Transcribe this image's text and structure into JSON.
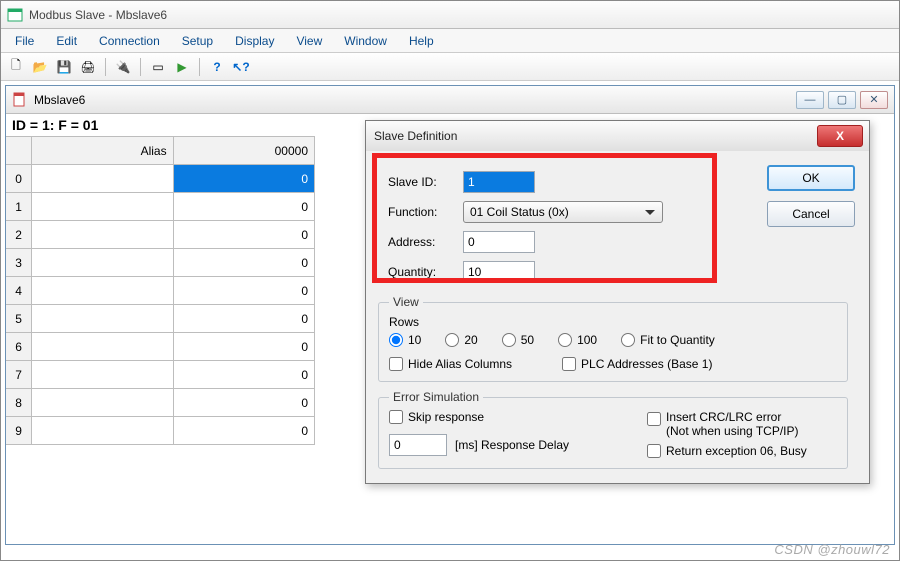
{
  "app": {
    "title": "Modbus Slave - Mbslave6",
    "icon": "app-icon"
  },
  "menu": [
    "File",
    "Edit",
    "Connection",
    "Setup",
    "Display",
    "View",
    "Window",
    "Help"
  ],
  "toolbar": [
    {
      "name": "new",
      "icon": "ico-new"
    },
    {
      "name": "open",
      "icon": "ico-open"
    },
    {
      "name": "save",
      "icon": "ico-save"
    },
    {
      "name": "print",
      "icon": "ico-print"
    },
    {
      "sep": true
    },
    {
      "name": "connection",
      "icon": "ico-cx"
    },
    {
      "sep": true
    },
    {
      "name": "window",
      "icon": "ico-win"
    },
    {
      "name": "run",
      "icon": "ico-run"
    },
    {
      "sep": true
    },
    {
      "name": "help",
      "icon": "ico-help"
    },
    {
      "name": "whats-this",
      "icon": "ico-ptr"
    }
  ],
  "doc": {
    "title": "Mbslave6",
    "status": "ID = 1: F = 01",
    "table": {
      "headers": {
        "rowh": "",
        "alias": "Alias",
        "value": "00000"
      },
      "rows": [
        {
          "n": "0",
          "alias": "",
          "value": "0",
          "selected": true
        },
        {
          "n": "1",
          "alias": "",
          "value": "0"
        },
        {
          "n": "2",
          "alias": "",
          "value": "0"
        },
        {
          "n": "3",
          "alias": "",
          "value": "0"
        },
        {
          "n": "4",
          "alias": "",
          "value": "0"
        },
        {
          "n": "5",
          "alias": "",
          "value": "0"
        },
        {
          "n": "6",
          "alias": "",
          "value": "0"
        },
        {
          "n": "7",
          "alias": "",
          "value": "0"
        },
        {
          "n": "8",
          "alias": "",
          "value": "0"
        },
        {
          "n": "9",
          "alias": "",
          "value": "0"
        }
      ]
    }
  },
  "dialog": {
    "title": "Slave Definition",
    "labels": {
      "slaveId": "Slave ID:",
      "function": "Function:",
      "address": "Address:",
      "quantity": "Quantity:"
    },
    "values": {
      "slaveId": "1",
      "function": "01 Coil Status (0x)",
      "address": "0",
      "quantity": "10"
    },
    "buttons": {
      "ok": "OK",
      "cancel": "Cancel"
    },
    "view": {
      "legend": "View",
      "rowsLabel": "Rows",
      "rowsOptions": [
        {
          "label": "10",
          "value": "10",
          "checked": true
        },
        {
          "label": "20",
          "value": "20"
        },
        {
          "label": "50",
          "value": "50"
        },
        {
          "label": "100",
          "value": "100"
        },
        {
          "label": "Fit to Quantity",
          "value": "fit"
        }
      ],
      "hideAlias": {
        "label": "Hide Alias Columns",
        "checked": false
      },
      "plcAddr": {
        "label": "PLC Addresses (Base 1)",
        "checked": false
      }
    },
    "error": {
      "legend": "Error Simulation",
      "skip": {
        "label": "Skip response",
        "checked": false
      },
      "delayValue": "0",
      "delayLabel": "[ms] Response Delay",
      "crc": {
        "label": "Insert CRC/LRC error\n(Not when using TCP/IP)",
        "checked": false
      },
      "exc": {
        "label": "Return exception 06, Busy",
        "checked": false
      }
    }
  },
  "watermark": "CSDN @zhouwl72"
}
